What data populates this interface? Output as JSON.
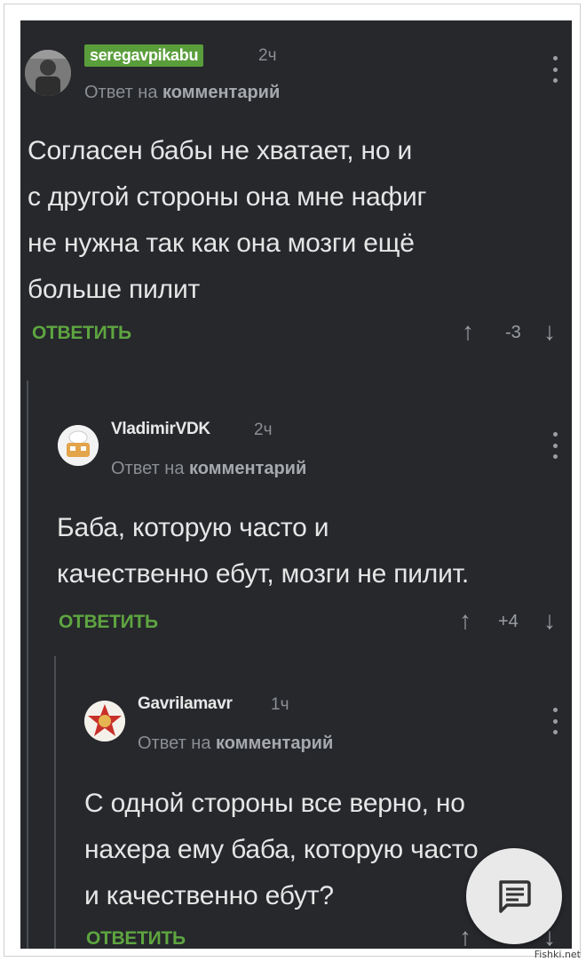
{
  "comments": [
    {
      "user": "seregavpikabu",
      "time": "2ч",
      "reply_prefix": "Ответ на",
      "reply_target": "комментарий",
      "lines": [
        "Согласен бабы не хватает, но и",
        "с другой стороны она мне нафиг",
        "не нужна так как она мозги ещё",
        "больше пилит"
      ],
      "reply_label": "ОТВЕТИТЬ",
      "score": "-3",
      "up_icon": "↑",
      "down_icon": "↓"
    },
    {
      "user": "VladimirVDK",
      "time": "2ч",
      "reply_prefix": "Ответ на",
      "reply_target": "комментарий",
      "lines": [
        "Баба, которую часто и",
        "качественно ебут, мозги не пилит."
      ],
      "reply_label": "ОТВЕТИТЬ",
      "score": "+4",
      "up_icon": "↑",
      "down_icon": "↓"
    },
    {
      "user": "Gavrilamavr",
      "time": "1ч",
      "reply_prefix": "Ответ на",
      "reply_target": "комментарий",
      "lines": [
        "С одной стороны все верно, но",
        "нахера ему баба, которую часто",
        "и качественно ебут?"
      ],
      "reply_label": "ОТВЕТИТЬ",
      "up_icon": "↑",
      "down_icon": "↓"
    }
  ],
  "fab": {
    "icon": "comment-icon"
  },
  "watermark": "Fishki.net"
}
